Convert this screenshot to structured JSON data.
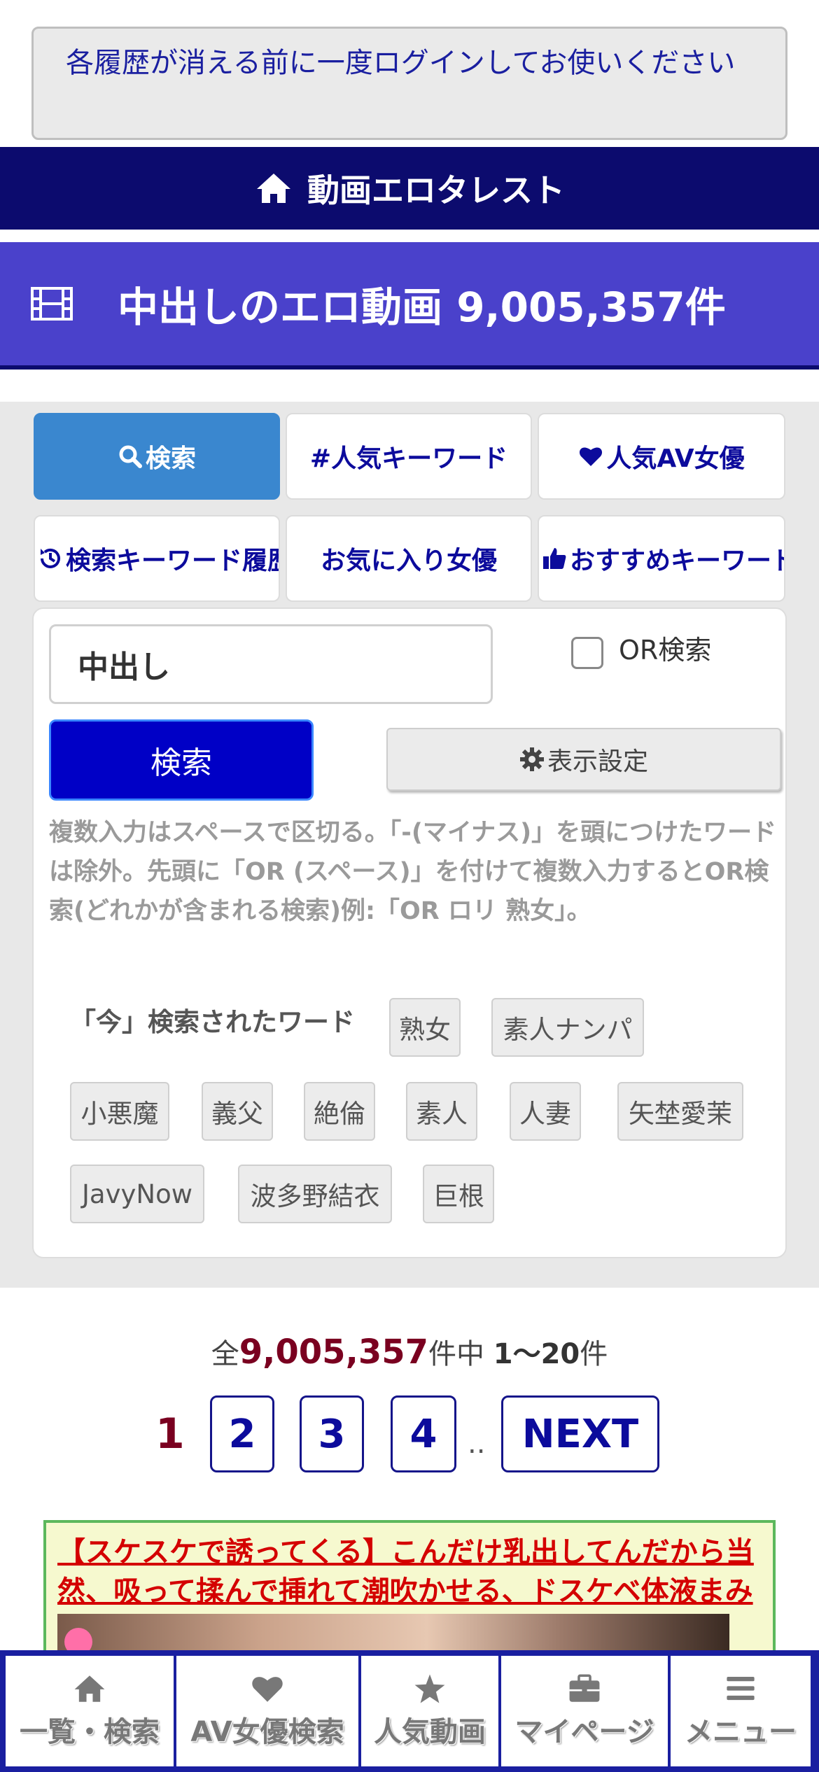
{
  "notice": {
    "text": "各履歴が消える前に一度ログインしてお使いください"
  },
  "brand": {
    "title": "動画エロタレスト"
  },
  "heading": {
    "title": "中出しのエロ動画 9,005,357件"
  },
  "tabs": [
    {
      "label": "検索"
    },
    {
      "label": "#人気キーワード"
    },
    {
      "label": "人気AV女優"
    },
    {
      "label": "検索キーワード履歴"
    },
    {
      "label": "お気に入り女優"
    },
    {
      "label": "おすすめキーワード"
    }
  ],
  "search": {
    "value": "中出し",
    "or_label": "OR検索",
    "button": "検索",
    "settings": "表示設定"
  },
  "help": {
    "text": "複数入力はスペースで区切る。「-(マイナス)」を頭につけたワードは除外。先頭に「OR (スペース)」を付けて複数入力するとOR検索(どれかが含まれる検索)例:「OR ロリ 熟女」。"
  },
  "trending": {
    "label": "「今」検索されたワード",
    "words": [
      "熟女",
      "素人ナンパ",
      "小悪魔",
      "義父",
      "絶倫",
      "素人",
      "人妻",
      "矢埜愛茉",
      "JavyNow",
      "波多野結衣",
      "巨根"
    ]
  },
  "results": {
    "prefix": "全",
    "total": "9,005,357",
    "middle": "件中",
    "range": "1〜20",
    "suffix": "件"
  },
  "pagination": {
    "current": "1",
    "pages": [
      "2",
      "3",
      "4"
    ],
    "dots": "..",
    "next": "NEXT"
  },
  "ad": {
    "title": "【スケスケで誘ってくる】こんだけ乳出してんだから当然、吸って揉んで挿れて潮吹かせる、ドスケベ体液まみれ"
  },
  "bottom_nav": [
    {
      "label": "一覧・検索",
      "icon": "home-icon"
    },
    {
      "label": "AV女優検索",
      "icon": "heart-icon"
    },
    {
      "label": "人気動画",
      "icon": "star-icon"
    },
    {
      "label": "マイページ",
      "icon": "briefcase-icon"
    },
    {
      "label": "メニュー",
      "icon": "menu-icon"
    }
  ],
  "colors": {
    "brand_navy": "#0c0b6e",
    "heading_purple": "#4a41cb",
    "active_tab": "#3a87cf",
    "search_button": "#0000c6",
    "count_red": "#7a0020"
  }
}
